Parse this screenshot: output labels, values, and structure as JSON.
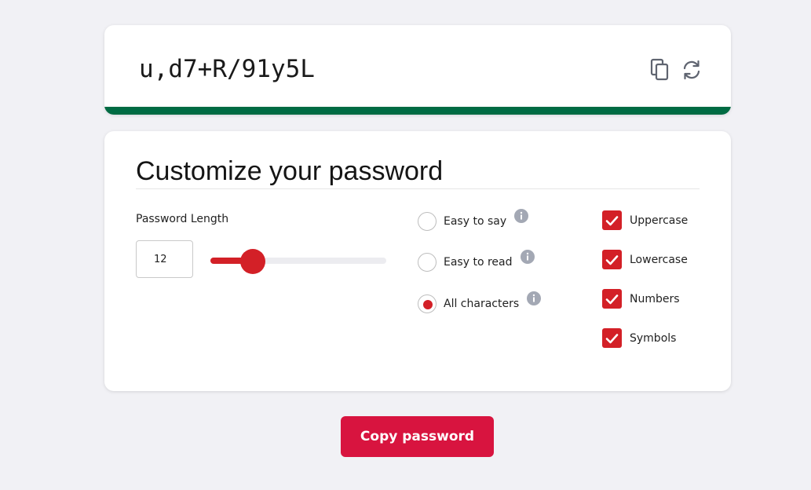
{
  "password": {
    "value": "u,d7+R/91y5L",
    "copy_icon": "copy-icon",
    "refresh_icon": "refresh-icon",
    "strength_color": "#006b43"
  },
  "options": {
    "title": "Customize your password",
    "length": {
      "label": "Password Length",
      "value": "12",
      "min": 1,
      "max": 50,
      "slider_fraction": 0.24
    },
    "modes": [
      {
        "label": "Easy to say",
        "selected": false,
        "icon": "info-icon"
      },
      {
        "label": "Easy to read",
        "selected": false,
        "icon": "info-icon"
      },
      {
        "label": "All characters",
        "selected": true,
        "icon": "info-icon"
      }
    ],
    "character_types": [
      {
        "label": "Uppercase",
        "checked": true
      },
      {
        "label": "Lowercase",
        "checked": true
      },
      {
        "label": "Numbers",
        "checked": true
      },
      {
        "label": "Symbols",
        "checked": true
      }
    ]
  },
  "copy_button": {
    "label": "Copy password"
  },
  "colors": {
    "accent": "#d32027",
    "button": "#d8143f",
    "info_icon": "#a3a8b4",
    "page_bg": "#f1f1f5"
  }
}
